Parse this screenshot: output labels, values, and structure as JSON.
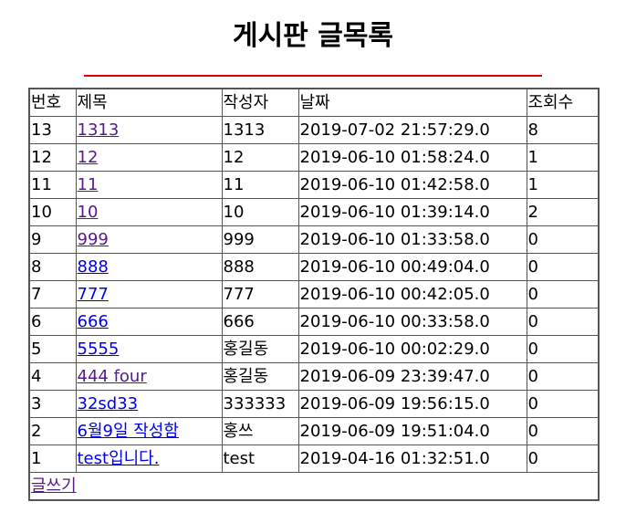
{
  "page": {
    "title": "게시판 글목록"
  },
  "colors": {
    "divider": "#e00000",
    "visited_link": "#551a8b",
    "unvisited_link": "#0000ee",
    "border": "#555555"
  },
  "table": {
    "headers": {
      "num": "번호",
      "subject": "제목",
      "writer": "작성자",
      "date": "날짜",
      "views": "조회수"
    },
    "rows": [
      {
        "num": "13",
        "subject": "1313",
        "writer": "1313",
        "date": "2019-07-02 21:57:29.0",
        "views": "8",
        "visited": true
      },
      {
        "num": "12",
        "subject": "12",
        "writer": "12",
        "date": "2019-06-10 01:58:24.0",
        "views": "1",
        "visited": true
      },
      {
        "num": "11",
        "subject": "11",
        "writer": "11",
        "date": "2019-06-10 01:42:58.0",
        "views": "1",
        "visited": true
      },
      {
        "num": "10",
        "subject": "10",
        "writer": "10",
        "date": "2019-06-10 01:39:14.0",
        "views": "2",
        "visited": true
      },
      {
        "num": "9",
        "subject": "999",
        "writer": "999",
        "date": "2019-06-10 01:33:58.0",
        "views": "0",
        "visited": true
      },
      {
        "num": "8",
        "subject": "888",
        "writer": "888",
        "date": "2019-06-10 00:49:04.0",
        "views": "0",
        "visited": false
      },
      {
        "num": "7",
        "subject": "777",
        "writer": "777",
        "date": "2019-06-10 00:42:05.0",
        "views": "0",
        "visited": false
      },
      {
        "num": "6",
        "subject": "666",
        "writer": "666",
        "date": "2019-06-10 00:33:58.0",
        "views": "0",
        "visited": false
      },
      {
        "num": "5",
        "subject": "5555",
        "writer": "홍길동",
        "date": "2019-06-10 00:02:29.0",
        "views": "0",
        "visited": false
      },
      {
        "num": "4",
        "subject": "444 four",
        "writer": "홍길동",
        "date": "2019-06-09 23:39:47.0",
        "views": "0",
        "visited": true
      },
      {
        "num": "3",
        "subject": "32sd33",
        "writer": "333333",
        "date": "2019-06-09 19:56:15.0",
        "views": "0",
        "visited": false
      },
      {
        "num": "2",
        "subject": "6월9일 작성함",
        "writer": "홍쓰",
        "date": "2019-06-09 19:51:04.0",
        "views": "0",
        "visited": false
      },
      {
        "num": "1",
        "subject": "test입니다.",
        "writer": "test",
        "date": "2019-04-16 01:32:51.0",
        "views": "0",
        "visited": false
      }
    ],
    "write_link": "글쓰기"
  }
}
